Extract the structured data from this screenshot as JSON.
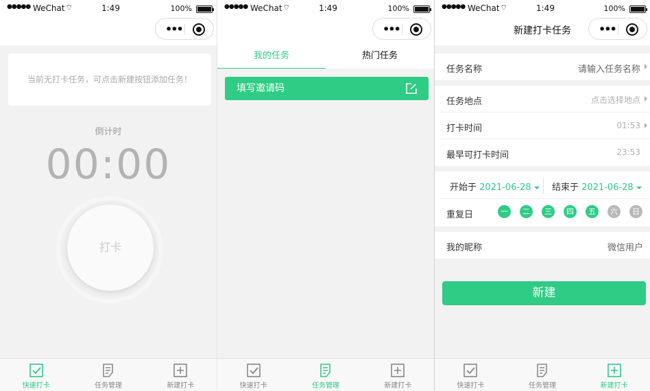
{
  "statusbar": {
    "carrier": "WeChat",
    "time": "1:49",
    "battery": "100%",
    "signal": "●●●●●",
    "wifi": "⌔"
  },
  "capsule": {
    "dots": "•••"
  },
  "tabbar": [
    {
      "label": "快速打卡",
      "icon": "checkbox-icon"
    },
    {
      "label": "任务管理",
      "icon": "document-icon"
    },
    {
      "label": "新建打卡",
      "icon": "plus-square-icon"
    }
  ],
  "screen1": {
    "notice": "当前无打卡任务，可点击新建按钮添加任务！",
    "countdown_label": "倒计时",
    "countdown": "00:00",
    "punch_label": "打卡"
  },
  "screen2": {
    "tabs": [
      "我的任务",
      "热门任务"
    ],
    "invite_label": "填写邀请码"
  },
  "screen3": {
    "title": "新建打卡任务",
    "task_name_label": "任务名称",
    "task_name_placeholder": "请输入任务名称",
    "location_label": "任务地点",
    "location_placeholder": "点击选择地点",
    "checkin_time_label": "打卡时间",
    "checkin_time": "01:53",
    "earliest_label": "最早可打卡时间",
    "earliest_time": "23:53",
    "start_label": "开始于",
    "start_date": "2021-06-28",
    "end_label": "结束于",
    "end_date": "2021-06-28",
    "repeat_label": "重复日",
    "days": [
      {
        "label": "一",
        "on": true
      },
      {
        "label": "二",
        "on": true
      },
      {
        "label": "三",
        "on": true
      },
      {
        "label": "四",
        "on": true
      },
      {
        "label": "五",
        "on": true
      },
      {
        "label": "六",
        "on": false
      },
      {
        "label": "日",
        "on": false
      }
    ],
    "nickname_label": "我的昵称",
    "nickname": "微信用户",
    "create_label": "新建"
  },
  "colors": {
    "accent": "#2ecc84",
    "inactive": "#888888"
  }
}
